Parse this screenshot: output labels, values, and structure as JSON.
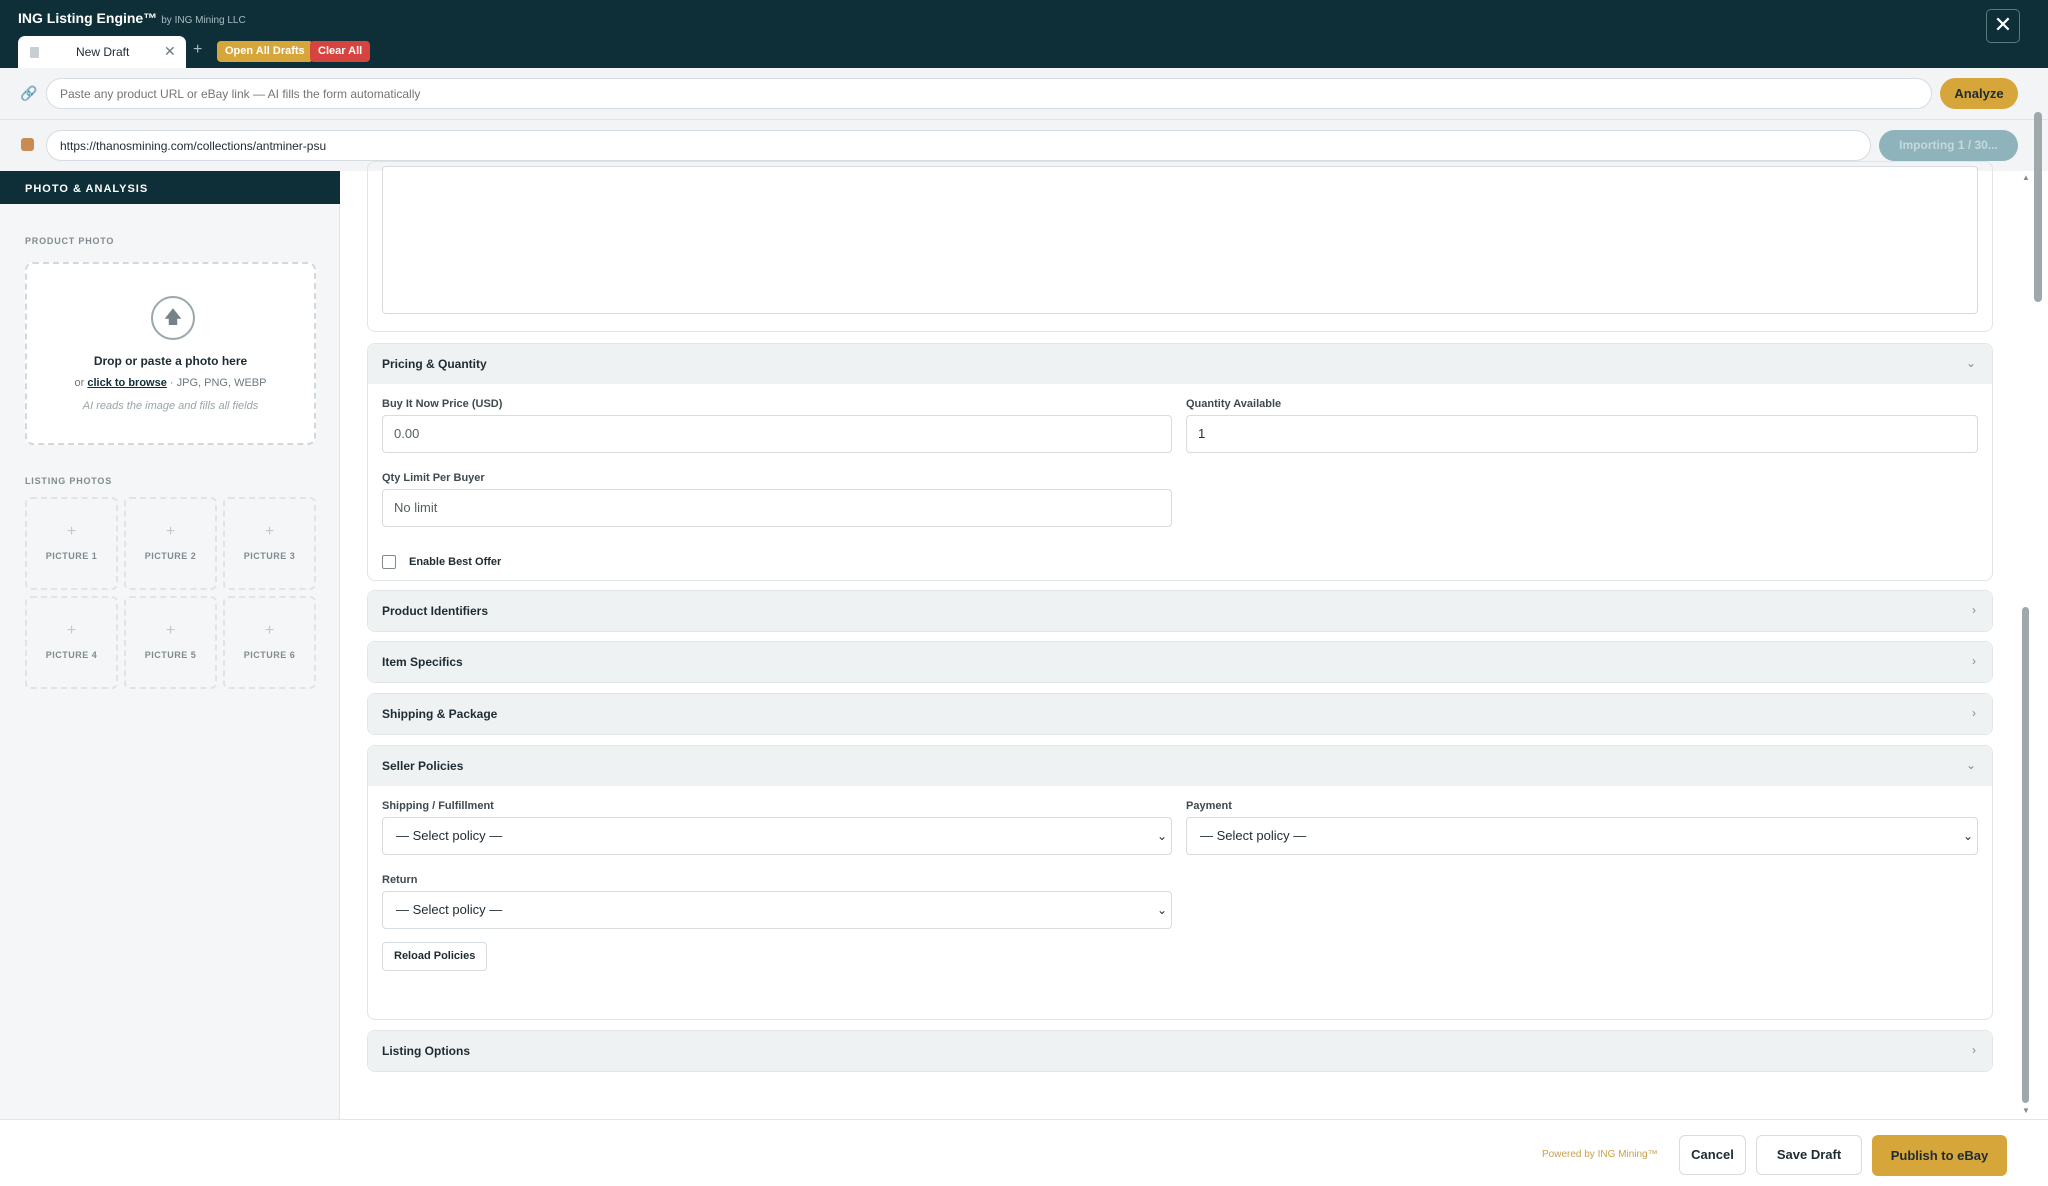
{
  "app": {
    "title": "ING Listing Engine™",
    "subtitle": "by ING Mining LLC"
  },
  "tabs": {
    "active_label": "New Draft",
    "add": "+",
    "open_all": "Open All Drafts",
    "clear_all": "Clear All"
  },
  "url_bar": {
    "placeholder": "Paste any product URL or eBay link — AI fills the form automatically",
    "analyze_label": "Analyze"
  },
  "import_bar": {
    "value": "https://thanosmining.com/collections/antminer-psu",
    "button_label": "Importing 1 / 30..."
  },
  "sidebar": {
    "header": "PHOTO & ANALYSIS",
    "product_photo_label": "PRODUCT PHOTO",
    "dropzone": {
      "title": "Drop or paste a photo here",
      "or": "or",
      "browse": "click to browse",
      "formats": "· JPG, PNG, WEBP",
      "note": "AI reads the image and fills all fields"
    },
    "listing_photos_label": "LISTING PHOTOS",
    "pictures": [
      "PICTURE 1",
      "PICTURE 2",
      "PICTURE 3",
      "PICTURE 4",
      "PICTURE 5",
      "PICTURE 6"
    ]
  },
  "pricing": {
    "title": "Pricing & Quantity",
    "price_label": "Buy It Now Price (USD)",
    "price_placeholder": "0.00",
    "qty_label": "Quantity Available",
    "qty_value": "1",
    "limit_label": "Qty Limit Per Buyer",
    "limit_placeholder": "No limit",
    "best_offer_label": "Enable Best Offer"
  },
  "sections": {
    "identifiers": "Product Identifiers",
    "specifics": "Item Specifics",
    "shipping": "Shipping & Package",
    "listing_options": "Listing Options"
  },
  "policies": {
    "title": "Seller Policies",
    "shipping_label": "Shipping / Fulfillment",
    "payment_label": "Payment",
    "return_label": "Return",
    "select_placeholder": "— Select policy —",
    "reload_label": "Reload Policies"
  },
  "footer": {
    "powered": "Powered by ING Mining™",
    "cancel": "Cancel",
    "save": "Save Draft",
    "publish": "Publish to eBay"
  },
  "colors": {
    "header_bg": "#0e2f38",
    "accent": "#d7a63a",
    "danger": "#d6443f"
  }
}
